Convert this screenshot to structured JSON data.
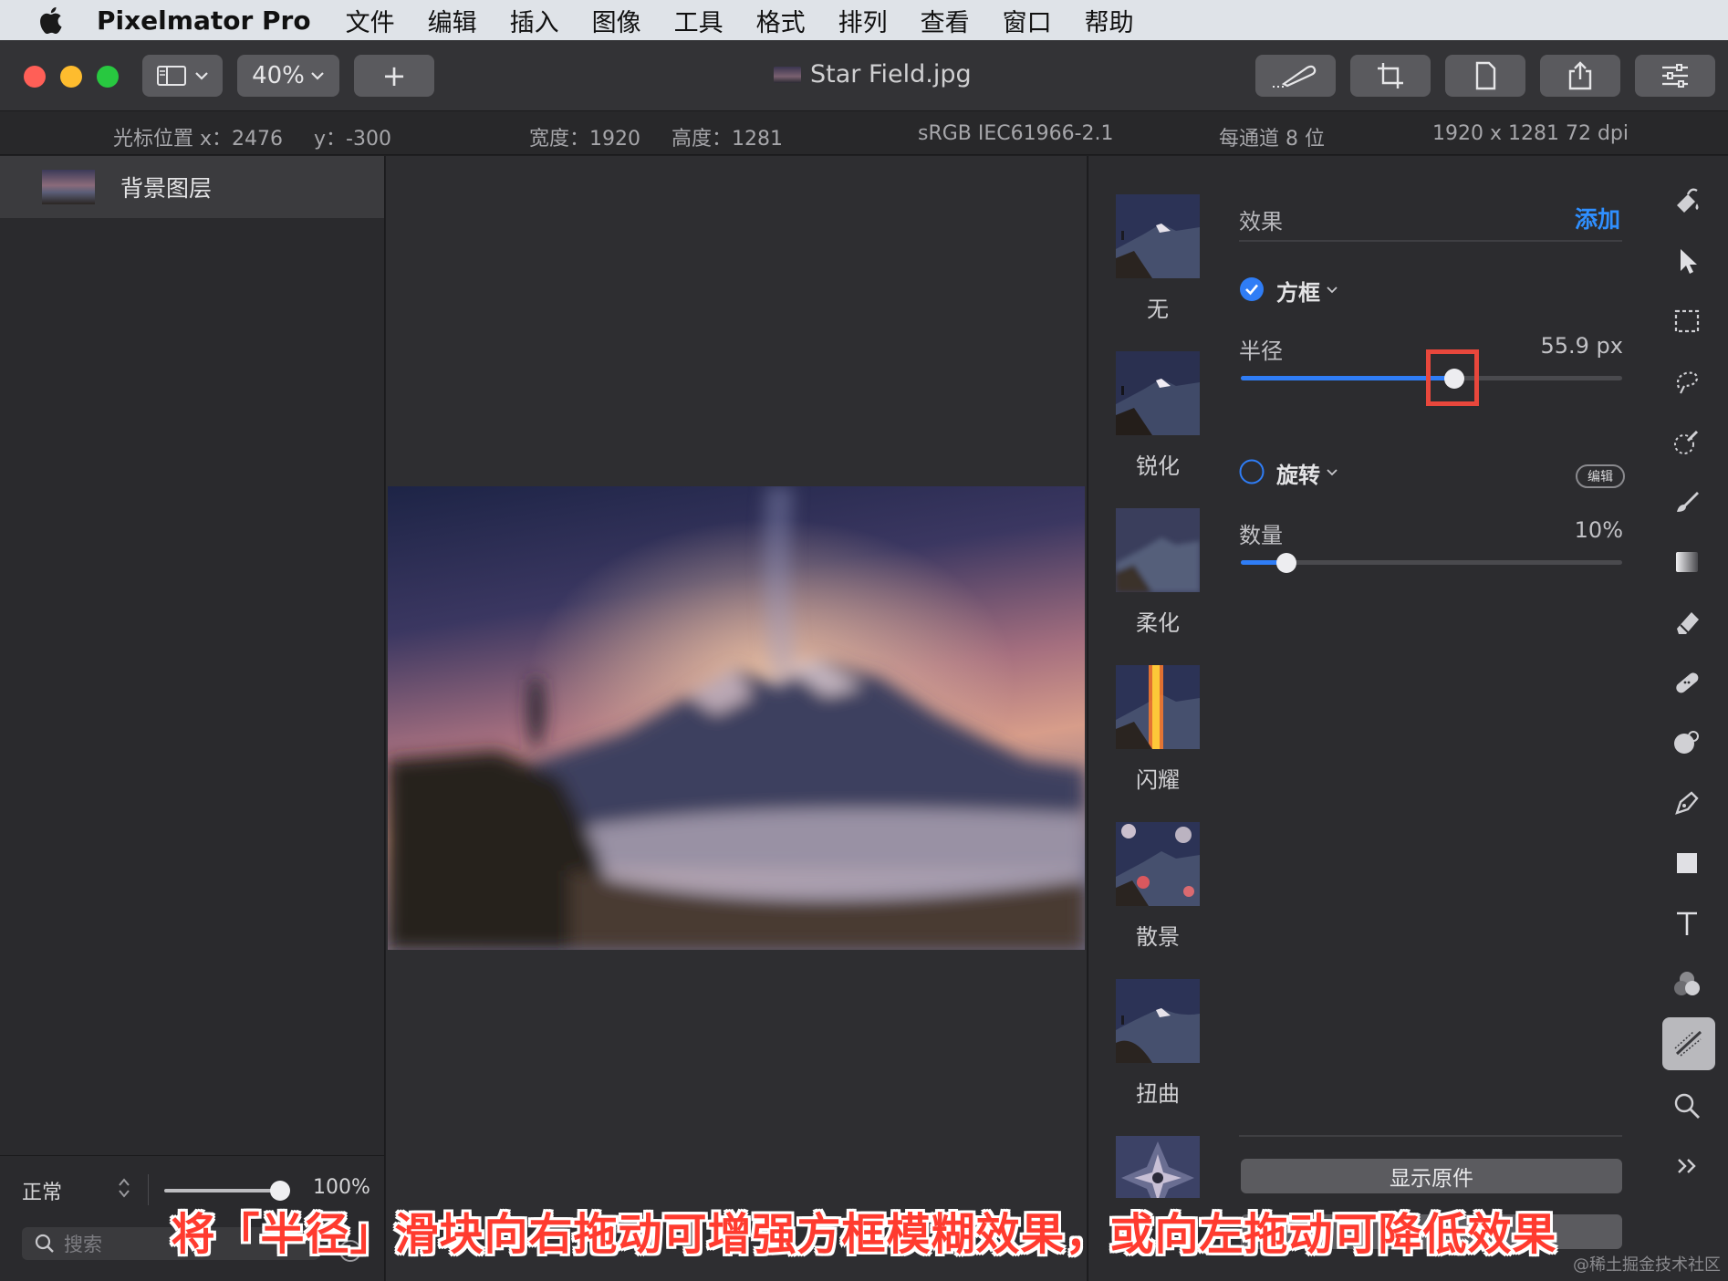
{
  "menubar": {
    "app_name": "Pixelmator Pro",
    "items": [
      "文件",
      "编辑",
      "插入",
      "图像",
      "工具",
      "格式",
      "排列",
      "查看",
      "窗口",
      "帮助"
    ]
  },
  "toolbar": {
    "zoom_label": "40%",
    "add_label": "+",
    "document_title": "Star Field.jpg"
  },
  "infobar": {
    "cursor_label": "光标位置 x：2476",
    "cursor_y": "y：-300",
    "width": "宽度：1920",
    "height": "高度：1281",
    "color_profile": "sRGB IEC61966-2.1",
    "bit_depth": "每通道 8 位",
    "dimensions": "1920 x 1281 72 dpi"
  },
  "layers": {
    "items": [
      {
        "name": "背景图层"
      }
    ],
    "blend_mode": "正常",
    "opacity": "100%",
    "opacity_value": 1.0,
    "search_placeholder": "搜索"
  },
  "effects_browser": {
    "presets": [
      "无",
      "锐化",
      "柔化",
      "闪耀",
      "散景",
      "扭曲"
    ],
    "section_title": "效果",
    "add_label": "添加",
    "effects": [
      {
        "name": "方框",
        "enabled": true,
        "param_label": "半径",
        "param_value": "55.9 px",
        "slider_fraction": 0.56
      },
      {
        "name": "旋转",
        "enabled": false,
        "badge": "编辑",
        "param_label": "数量",
        "param_value": "10%",
        "slider_fraction": 0.12
      }
    ],
    "show_original_label": "显示原件"
  },
  "tools": [
    "paint-bucket-icon",
    "arrow-select-icon",
    "rect-select-icon",
    "lasso-icon",
    "color-picker-icon",
    "brush-icon",
    "gradient-icon",
    "eraser-icon",
    "repair-icon",
    "clone-icon",
    "pen-icon",
    "shape-icon",
    "text-icon",
    "color-adjust-icon",
    "effects-icon",
    "zoom-icon",
    "more-icon"
  ],
  "caption": "将「半径」滑块向右拖动可增强方框模糊效果，或向左拖动可降低效果",
  "watermark": "@稀土掘金技术社区",
  "colors": {
    "accent": "#2f7df6",
    "highlight": "#e8473c",
    "caption": "#ff3b2f"
  }
}
